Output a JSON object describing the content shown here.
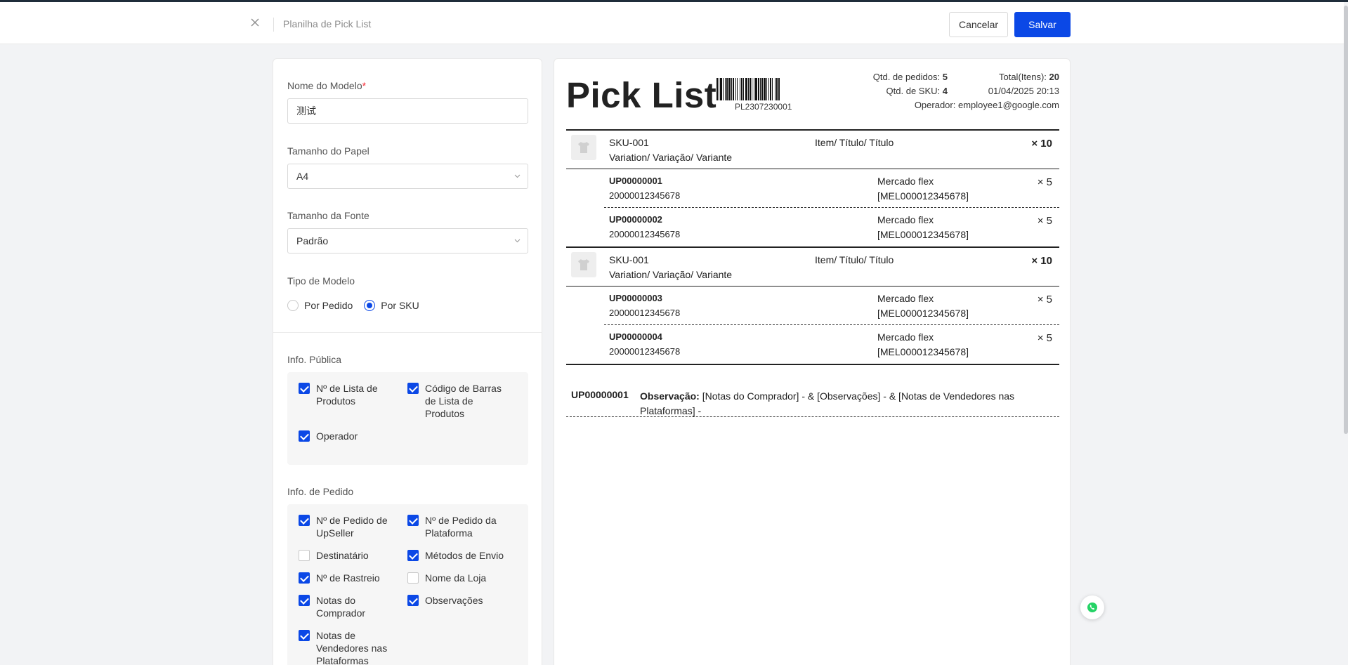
{
  "header": {
    "title": "Planilha de Pick List",
    "cancel_label": "Cancelar",
    "save_label": "Salvar"
  },
  "form": {
    "model_name_label": "Nome do Modelo",
    "model_name_required": "*",
    "model_name_value": "测试",
    "paper_size_label": "Tamanho do Papel",
    "paper_size_value": "A4",
    "font_size_label": "Tamanho da Fonte",
    "font_size_value": "Padrão",
    "model_type_label": "Tipo de Modelo",
    "model_type_options": [
      "Por Pedido",
      "Por SKU"
    ],
    "model_type_selected": "Por SKU"
  },
  "public_info": {
    "title": "Info. Pública",
    "items": [
      {
        "label": "Nº de Lista de Produtos",
        "checked": true
      },
      {
        "label": "Código de Barras de Lista de Produtos",
        "checked": true
      },
      {
        "label": "Operador",
        "checked": true
      }
    ]
  },
  "order_info": {
    "title": "Info. de Pedido",
    "items": [
      {
        "label": "Nº de Pedido de UpSeller",
        "checked": true
      },
      {
        "label": "Nº de Pedido da Plataforma",
        "checked": true
      },
      {
        "label": "Destinatário",
        "checked": false
      },
      {
        "label": "Métodos de Envio",
        "checked": true
      },
      {
        "label": "Nº de Rastreio",
        "checked": true
      },
      {
        "label": "Nome da Loja",
        "checked": false
      },
      {
        "label": "Notas do Comprador",
        "checked": true
      },
      {
        "label": "Observações",
        "checked": true
      },
      {
        "label": "Notas de Vendedores nas Plataformas",
        "checked": true
      }
    ]
  },
  "preview": {
    "title": "Pick List",
    "barcode_text": "PL2307230001",
    "orders_label": "Qtd. de pedidos:",
    "orders_value": "5",
    "total_label": "Total(Itens):",
    "total_value": "20",
    "sku_count_label": "Qtd. de SKU:",
    "sku_count_value": "4",
    "datetime": "01/04/2025 20:13",
    "operator_label": "Operador:",
    "operator_value": "employee1@google.com",
    "skus": [
      {
        "code": "SKU-001",
        "variation": "Variation/ Variação/ Variante",
        "title": "Item/ Título/ Título",
        "qty": "× 10",
        "orders": [
          {
            "no": "UP00000001",
            "barcode": "20000012345678",
            "ship": "Mercado flex",
            "ml": "[MEL000012345678]",
            "qty": "× 5"
          },
          {
            "no": "UP00000002",
            "barcode": "20000012345678",
            "ship": "Mercado flex",
            "ml": "[MEL000012345678]",
            "qty": "× 5"
          }
        ]
      },
      {
        "code": "SKU-001",
        "variation": "Variation/ Variação/ Variante",
        "title": "Item/ Título/ Título",
        "qty": "× 10",
        "orders": [
          {
            "no": "UP00000003",
            "barcode": "20000012345678",
            "ship": "Mercado flex",
            "ml": "[MEL000012345678]",
            "qty": "× 5"
          },
          {
            "no": "UP00000004",
            "barcode": "20000012345678",
            "ship": "Mercado flex",
            "ml": "[MEL000012345678]",
            "qty": "× 5"
          }
        ]
      }
    ],
    "observation": {
      "order_no": "UP00000001",
      "label": "Observação:",
      "text": "[Notas do Comprador] - & [Observações] - & [Notas de Vendedores nas Plataformas] -"
    }
  },
  "colors": {
    "accent": "#0b48e6",
    "required": "#f5222d",
    "whatsapp": "#25d366"
  },
  "icons": {
    "close": "close-icon",
    "chevron": "chevron-down-icon",
    "shirt": "shirt-icon",
    "chat": "whatsapp-icon"
  }
}
